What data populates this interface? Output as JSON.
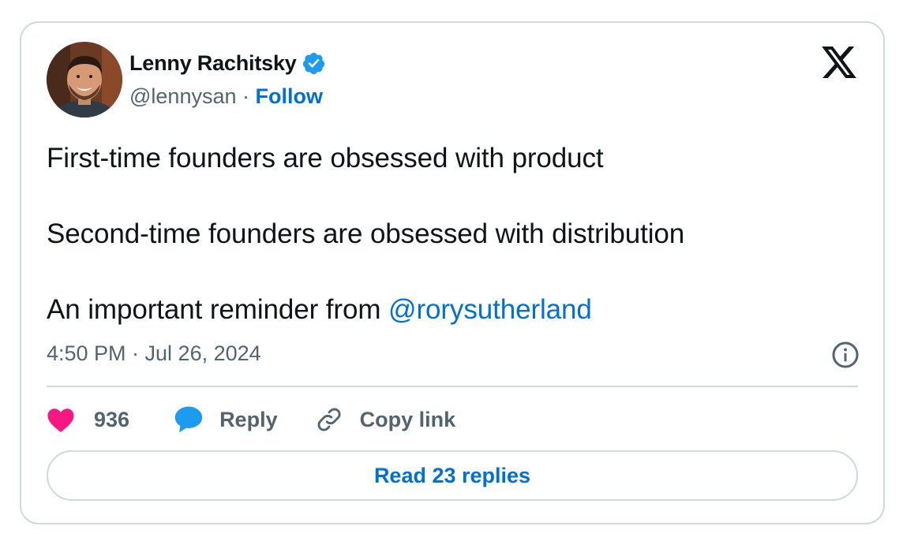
{
  "author": {
    "name": "Lenny Rachitsky",
    "handle": "@lennysan",
    "separator": "·",
    "follow_label": "Follow",
    "verified": true
  },
  "tweet": {
    "lines": [
      "First-time founders are obsessed with product",
      "Second-time founders are obsessed with distribution"
    ],
    "line3_text": "An important reminder from ",
    "mention": "@rorysutherland",
    "timestamp": "4:50 PM · Jul 26, 2024"
  },
  "actions": {
    "like_count": "936",
    "reply_label": "Reply",
    "copy_link_label": "Copy link"
  },
  "read_replies_label": "Read 23 replies",
  "icons": {
    "logo": "x-logo-icon",
    "verified": "verified-badge-icon",
    "info": "info-icon",
    "like": "heart-icon",
    "reply": "speech-bubble-icon",
    "copy": "link-icon"
  },
  "colors": {
    "link": "#006fd6",
    "secondary_text": "#536471",
    "border": "#cfd9de",
    "heart": "#f91880",
    "reply_bubble": "#1d9bf0",
    "verified": "#1d9bf0"
  }
}
